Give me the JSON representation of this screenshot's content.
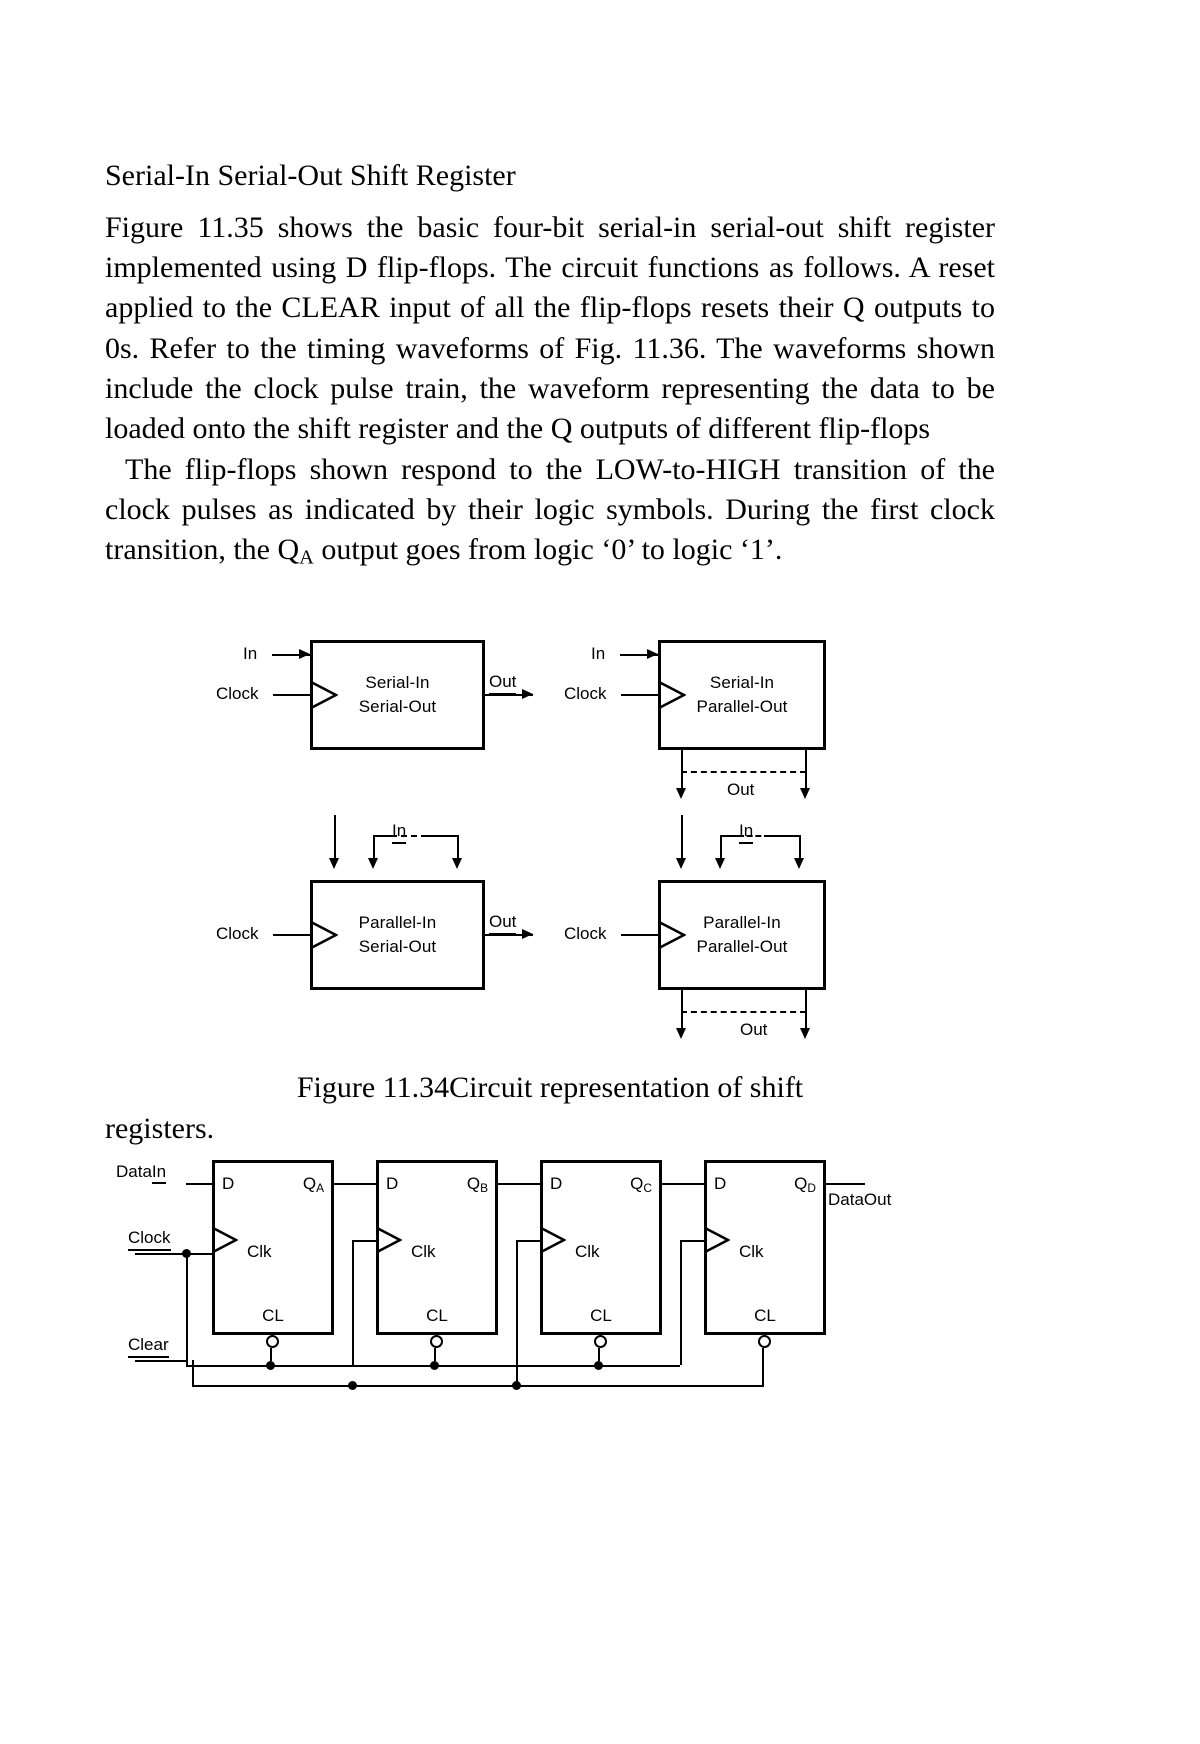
{
  "document": {
    "heading": "Serial-In Serial-Out Shift Register",
    "paragraph1_a": "Figure 11.35 shows the basic four-bit serial-in serial-out shift register implemented using D flip-flops. The circuit functions as follows. A reset applied to the CLEAR input of all the flip-flops resets their Q outputs to 0s. Refer to the timing waveforms of Fig. 11.36. The waveforms shown include the clock pulse train, the waveform representing the data to be loaded onto the shift register and the Q outputs of different flip-flops",
    "paragraph2_a": "The flip-flops shown respond to the LOW-to-HIGH transition of the clock pulses as indicated by their logic symbols. During the first clock transition, the Q",
    "paragraph2_sub": "A",
    "paragraph2_b": " output goes from logic ‘0’ to logic ‘1’."
  },
  "figure": {
    "caption_line1": "Figure 11.34Circuit representation of shift",
    "caption_line2": "registers.",
    "blocks": [
      {
        "id": "serial-in-serial-out",
        "title_line1": "Serial-In",
        "title_line2": "Serial-Out",
        "input_label": "In",
        "clock_label": "Clock",
        "output_label": "Out"
      },
      {
        "id": "serial-in-parallel-out",
        "title_line1": "Serial-In",
        "title_line2": "Parallel-Out",
        "input_label": "In",
        "clock_label": "Clock",
        "output_label": "Out"
      },
      {
        "id": "parallel-in-serial-out",
        "title_line1": "Parallel-In",
        "title_line2": "Serial-Out",
        "input_label": "In",
        "clock_label": "Clock",
        "output_label": "Out"
      },
      {
        "id": "parallel-in-parallel-out",
        "title_line1": "Parallel-In",
        "title_line2": "Parallel-Out",
        "input_label": "In",
        "clock_label": "Clock",
        "output_label": "Out"
      }
    ]
  },
  "schematic": {
    "data_in_prefix": "Data",
    "data_in_suffix": "In",
    "clock_label": "Clock",
    "clear_label": "Clear",
    "data_out_label": "DataOut",
    "flipflops": [
      {
        "d": "D",
        "q": "Q",
        "q_sub": "A",
        "clk": "Clk",
        "cl": "CL"
      },
      {
        "d": "D",
        "q": "Q",
        "q_sub": "B",
        "clk": "Clk",
        "cl": "CL"
      },
      {
        "d": "D",
        "q": "Q",
        "q_sub": "C",
        "clk": "Clk",
        "cl": "CL"
      },
      {
        "d": "D",
        "q": "Q",
        "q_sub": "D",
        "clk": "Clk",
        "cl": "CL"
      }
    ]
  },
  "colors": {
    "ink": "#000000",
    "paper": "#ffffff"
  }
}
